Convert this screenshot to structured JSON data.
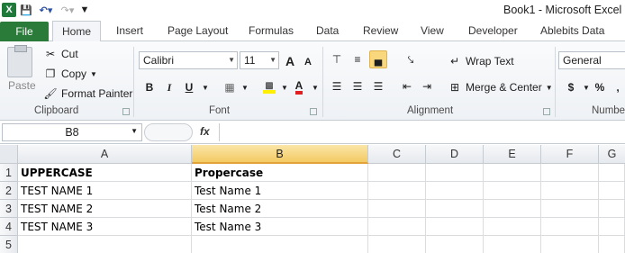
{
  "title_bar": {
    "title": "Book1 - Microsoft Excel n"
  },
  "tabs": {
    "file": "File",
    "items": [
      "Home",
      "Insert",
      "Page Layout",
      "Formulas",
      "Data",
      "Review",
      "View",
      "Developer",
      "Ablebits Data"
    ]
  },
  "ribbon": {
    "clipboard": {
      "paste": "Paste",
      "cut": "Cut",
      "copy": "Copy",
      "format_painter": "Format Painter",
      "group_label": "Clipboard"
    },
    "font": {
      "name": "Calibri",
      "size": "11",
      "bold": "B",
      "italic": "I",
      "underline": "U",
      "grow": "A",
      "shrink": "A",
      "font_color": "A",
      "group_label": "Font"
    },
    "alignment": {
      "wrap_text": "Wrap Text",
      "merge_center": "Merge & Center",
      "group_label": "Alignment"
    },
    "number": {
      "format": "General",
      "currency": "$",
      "percent": "%",
      "group_label": "Numbe"
    }
  },
  "formula_bar": {
    "name_box": "B8",
    "fx": "fx",
    "formula": ""
  },
  "sheet": {
    "columns": [
      "A",
      "B",
      "C",
      "D",
      "E",
      "F",
      "G"
    ],
    "selected_column": "B",
    "rows": [
      {
        "num": "1",
        "cells": [
          "UPPERCASE",
          "Propercase"
        ]
      },
      {
        "num": "2",
        "cells": [
          "TEST NAME 1",
          "Test Name 1"
        ]
      },
      {
        "num": "3",
        "cells": [
          "TEST NAME 2",
          "Test Name 2"
        ]
      },
      {
        "num": "4",
        "cells": [
          "TEST NAME 3",
          "Test Name 3"
        ]
      },
      {
        "num": "5",
        "cells": [
          "",
          ""
        ]
      }
    ]
  }
}
